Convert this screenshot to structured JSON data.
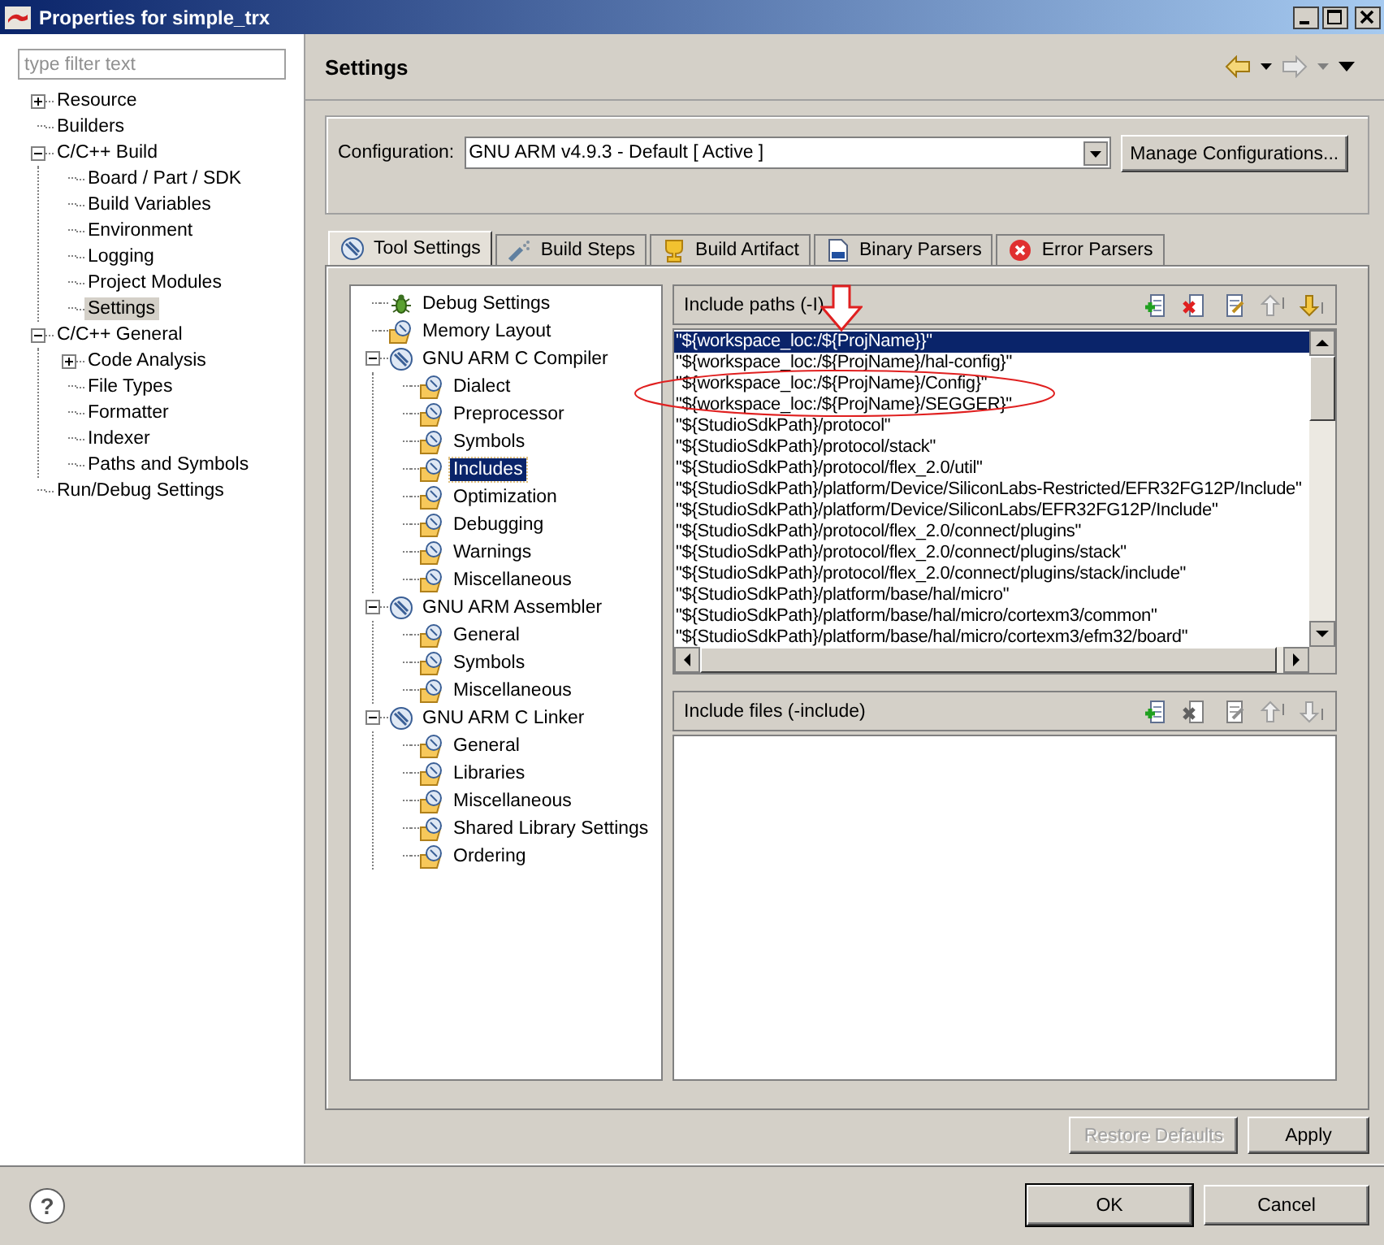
{
  "window": {
    "title": "Properties for simple_trx"
  },
  "filter": {
    "placeholder": "type filter text"
  },
  "nav_tree": [
    {
      "label": "Resource",
      "expanded": false,
      "selected": false
    },
    {
      "label": "Builders",
      "selected": false
    },
    {
      "label": "C/C++ Build",
      "expanded": true,
      "selected": false,
      "children": [
        {
          "label": "Board / Part / SDK",
          "selected": false
        },
        {
          "label": "Build Variables",
          "selected": false
        },
        {
          "label": "Environment",
          "selected": false
        },
        {
          "label": "Logging",
          "selected": false
        },
        {
          "label": "Project Modules",
          "selected": false
        },
        {
          "label": "Settings",
          "selected": true
        }
      ]
    },
    {
      "label": "C/C++ General",
      "expanded": true,
      "selected": false,
      "children": [
        {
          "label": "Code Analysis",
          "expanded": false,
          "selected": false
        },
        {
          "label": "File Types",
          "selected": false
        },
        {
          "label": "Formatter",
          "selected": false
        },
        {
          "label": "Indexer",
          "selected": false
        },
        {
          "label": "Paths and Symbols",
          "selected": false
        }
      ]
    },
    {
      "label": "Run/Debug Settings",
      "selected": false
    }
  ],
  "header": {
    "title": "Settings"
  },
  "configuration": {
    "label": "Configuration:",
    "value": "GNU ARM v4.9.3 - Default  [ Active ]",
    "button": "Manage Configurations..."
  },
  "tabs": [
    {
      "label": "Tool Settings",
      "kind": "tool",
      "selected": true
    },
    {
      "label": "Build Steps",
      "kind": "steps",
      "selected": false
    },
    {
      "label": "Build Artifact",
      "kind": "artifact",
      "selected": false
    },
    {
      "label": "Binary Parsers",
      "kind": "binary",
      "selected": false
    },
    {
      "label": "Error Parsers",
      "kind": "error",
      "selected": false
    }
  ],
  "tool_tree": [
    {
      "label": "Debug Settings",
      "kind": "debug",
      "selected": false
    },
    {
      "label": "Memory Layout",
      "kind": "option",
      "selected": false
    },
    {
      "label": "GNU ARM C Compiler",
      "kind": "tool",
      "expanded": true,
      "selected": false,
      "children": [
        {
          "label": "Dialect",
          "kind": "option",
          "selected": false
        },
        {
          "label": "Preprocessor",
          "kind": "option",
          "selected": false
        },
        {
          "label": "Symbols",
          "kind": "option",
          "selected": false
        },
        {
          "label": "Includes",
          "kind": "option",
          "selected": true
        },
        {
          "label": "Optimization",
          "kind": "option",
          "selected": false
        },
        {
          "label": "Debugging",
          "kind": "option",
          "selected": false
        },
        {
          "label": "Warnings",
          "kind": "option",
          "selected": false
        },
        {
          "label": "Miscellaneous",
          "kind": "option",
          "selected": false
        }
      ]
    },
    {
      "label": "GNU ARM Assembler",
      "kind": "tool",
      "expanded": true,
      "selected": false,
      "children": [
        {
          "label": "General",
          "kind": "option",
          "selected": false
        },
        {
          "label": "Symbols",
          "kind": "option",
          "selected": false
        },
        {
          "label": "Miscellaneous",
          "kind": "option",
          "selected": false
        }
      ]
    },
    {
      "label": "GNU ARM C Linker",
      "kind": "tool",
      "expanded": true,
      "selected": false,
      "children": [
        {
          "label": "General",
          "kind": "option",
          "selected": false
        },
        {
          "label": "Libraries",
          "kind": "option",
          "selected": false
        },
        {
          "label": "Miscellaneous",
          "kind": "option",
          "selected": false
        },
        {
          "label": "Shared Library Settings",
          "kind": "option",
          "selected": false
        },
        {
          "label": "Ordering",
          "kind": "option",
          "selected": false
        }
      ]
    }
  ],
  "include_paths": {
    "title": "Include paths (-I)",
    "tools": [
      {
        "kind": "add",
        "disabled": false
      },
      {
        "kind": "delete",
        "disabled": false
      },
      {
        "kind": "edit",
        "disabled": false
      },
      {
        "kind": "up",
        "disabled": true
      },
      {
        "kind": "down",
        "disabled": false
      }
    ],
    "items": [
      {
        "text": "\"${workspace_loc:/${ProjName}}\"",
        "selected": true
      },
      {
        "text": "\"${workspace_loc:/${ProjName}/hal-config}\"",
        "selected": false
      },
      {
        "text": "\"${workspace_loc:/${ProjName}/Config}\"",
        "selected": false
      },
      {
        "text": "\"${workspace_loc:/${ProjName}/SEGGER}\"",
        "selected": false
      },
      {
        "text": "\"${StudioSdkPath}/protocol\"",
        "selected": false
      },
      {
        "text": "\"${StudioSdkPath}/protocol/stack\"",
        "selected": false
      },
      {
        "text": "\"${StudioSdkPath}/protocol/flex_2.0/util\"",
        "selected": false
      },
      {
        "text": "\"${StudioSdkPath}/platform/Device/SiliconLabs-Restricted/EFR32FG12P/Include\"",
        "selected": false
      },
      {
        "text": "\"${StudioSdkPath}/platform/Device/SiliconLabs/EFR32FG12P/Include\"",
        "selected": false
      },
      {
        "text": "\"${StudioSdkPath}/protocol/flex_2.0/connect/plugins\"",
        "selected": false
      },
      {
        "text": "\"${StudioSdkPath}/protocol/flex_2.0/connect/plugins/stack\"",
        "selected": false
      },
      {
        "text": "\"${StudioSdkPath}/protocol/flex_2.0/connect/plugins/stack/include\"",
        "selected": false
      },
      {
        "text": "\"${StudioSdkPath}/platform/base/hal/micro\"",
        "selected": false
      },
      {
        "text": "\"${StudioSdkPath}/platform/base/hal/micro/cortexm3/common\"",
        "selected": false
      },
      {
        "text": "\"${StudioSdkPath}/platform/base/hal/micro/cortexm3/efm32/board\"",
        "selected": false
      }
    ]
  },
  "include_files": {
    "title": "Include files (-include)",
    "tools": [
      {
        "kind": "add",
        "disabled": false
      },
      {
        "kind": "delete",
        "disabled": true
      },
      {
        "kind": "edit",
        "disabled": true
      },
      {
        "kind": "up",
        "disabled": true
      },
      {
        "kind": "down",
        "disabled": true
      }
    ]
  },
  "page_buttons": [
    {
      "label": "Restore Defaults",
      "disabled": true
    },
    {
      "label": "Apply",
      "disabled": false
    }
  ],
  "help": "?",
  "dialog_buttons": [
    {
      "label": "OK",
      "default": true
    },
    {
      "label": "Cancel",
      "default": false
    }
  ]
}
